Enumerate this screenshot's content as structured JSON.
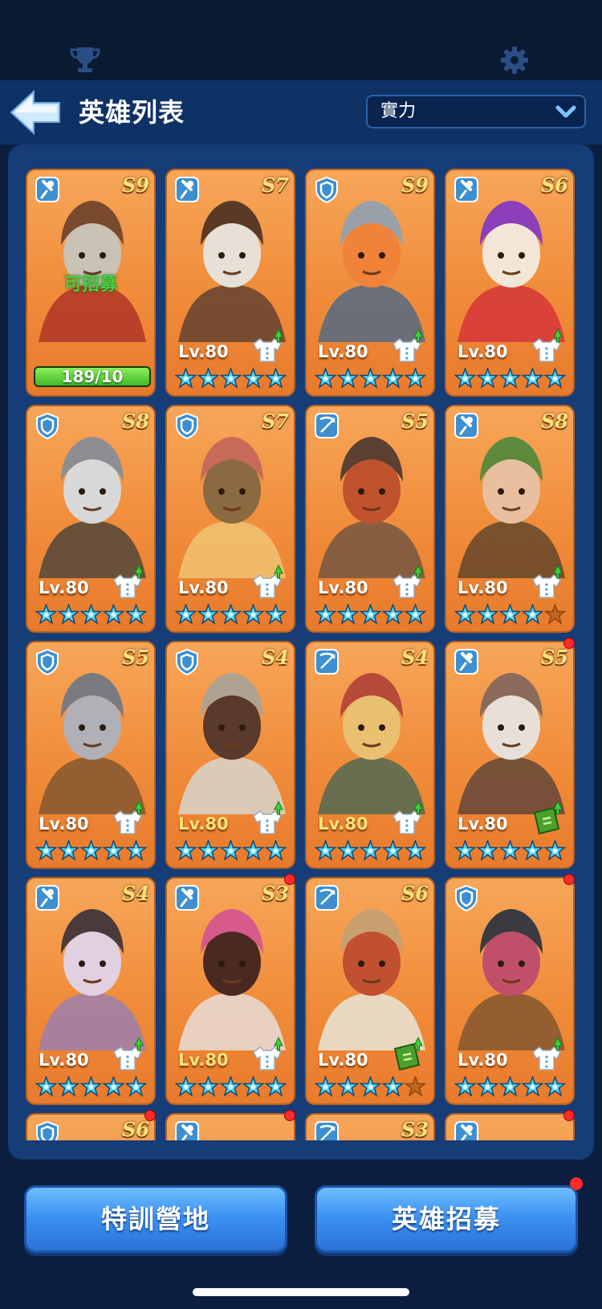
{
  "header": {
    "title": "英雄列表",
    "sort_value": "實力"
  },
  "buttons": {
    "training": "特訓營地",
    "recruit": "英雄招募"
  },
  "colors": {
    "card": "#f08c3a",
    "panel": "#163d78",
    "star": "#4fd2f0",
    "button": "#3a8ef0"
  },
  "heroes": [
    {
      "class": "archer-mage-icon",
      "grade": "S9",
      "recruitable": true,
      "recruit_label": "可招募",
      "shards": "189/10",
      "portrait": "fireman-elder"
    },
    {
      "class": "archer-mage-icon",
      "grade": "S7",
      "level": "Lv.80",
      "stars": 5,
      "portrait": "fur-coat-man"
    },
    {
      "class": "shield-icon",
      "grade": "S9",
      "level": "Lv.80",
      "stars": 5,
      "portrait": "viking-dwarf"
    },
    {
      "class": "archer-mage-icon",
      "grade": "S6",
      "level": "Lv.80",
      "stars": 5,
      "portrait": "clown"
    },
    {
      "class": "shield-icon",
      "grade": "S8",
      "level": "Lv.80",
      "stars": 5,
      "portrait": "masked-knight"
    },
    {
      "class": "shield-icon",
      "grade": "S7",
      "level": "Lv.80",
      "stars": 5,
      "portrait": "girl-lantern"
    },
    {
      "class": "crossbow-icon",
      "grade": "S5",
      "level": "Lv.80",
      "stars": 5,
      "portrait": "pilot-girl"
    },
    {
      "class": "archer-mage-icon",
      "grade": "S8",
      "level": "Lv.80",
      "stars": 4,
      "portrait": "frog-hood-girl"
    },
    {
      "class": "shield-icon",
      "grade": "S5",
      "level": "Lv.80",
      "stars": 5,
      "portrait": "gladiator"
    },
    {
      "class": "shield-icon",
      "grade": "S4",
      "level": "Lv.80",
      "gold_level": true,
      "stars": 5,
      "portrait": "hooded-man"
    },
    {
      "class": "crossbow-icon",
      "grade": "S4",
      "level": "Lv.80",
      "gold_level": true,
      "stars": 5,
      "portrait": "beret-woman"
    },
    {
      "class": "archer-mage-icon",
      "grade": "S5",
      "level": "Lv.80",
      "stars": 5,
      "book": true,
      "dot": true,
      "portrait": "aviator-woman"
    },
    {
      "class": "archer-mage-icon",
      "grade": "S4",
      "level": "Lv.80",
      "stars": 5,
      "portrait": "ninja-girl"
    },
    {
      "class": "archer-mage-icon",
      "grade": "S3",
      "level": "Lv.80",
      "gold_level": true,
      "stars": 5,
      "dot": true,
      "portrait": "earmuff-woman"
    },
    {
      "class": "crossbow-icon",
      "grade": "S6",
      "level": "Lv.80",
      "stars": 4,
      "book": true,
      "portrait": "cowboy"
    },
    {
      "class": "shield-icon",
      "grade": "",
      "level": "Lv.80",
      "stars": 5,
      "dot": true,
      "portrait": "bucket-helmet"
    },
    {
      "class": "shield-icon",
      "grade": "S6",
      "partial": true,
      "dot": true,
      "portrait": "partial"
    },
    {
      "class": "archer-mage-icon",
      "grade": "",
      "partial": true,
      "dot": true,
      "portrait": "partial"
    },
    {
      "class": "crossbow-icon",
      "grade": "S3",
      "partial": true,
      "portrait": "partial"
    },
    {
      "class": "archer-mage-icon",
      "grade": "",
      "partial": true,
      "dot": true,
      "portrait": "partial"
    }
  ]
}
